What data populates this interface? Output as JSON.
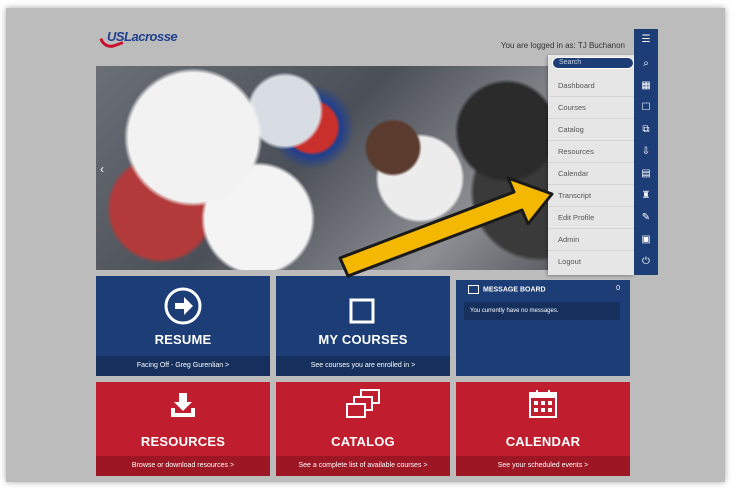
{
  "header": {
    "logo_text": "USLacrosse",
    "logged_in_text": "You are logged in as: TJ Buchanon"
  },
  "menu": {
    "search_placeholder": "Search",
    "items": [
      "Dashboard",
      "Courses",
      "Catalog",
      "Resources",
      "Calendar",
      "Transcript",
      "Edit Profile",
      "Admin",
      "Logout"
    ]
  },
  "iconbar": {
    "icons": [
      "menu-icon",
      "search-icon",
      "grid-icon",
      "courses-icon",
      "catalog-icon",
      "resources-icon",
      "calendar-icon",
      "transcript-icon",
      "edit-icon",
      "admin-icon",
      "power-icon"
    ]
  },
  "tiles": {
    "resume": {
      "label": "RESUME",
      "sub": "Facing Off - Greg Gurenlian  >"
    },
    "my_courses": {
      "label": "MY COURSES",
      "sub": "See courses you are enrolled in  >"
    },
    "resources": {
      "label": "RESOURCES",
      "sub": "Browse or download resources  >"
    },
    "catalog": {
      "label": "CATALOG",
      "sub": "See a complete list of available courses  >"
    },
    "calendar": {
      "label": "CALENDAR",
      "sub": "See your scheduled events  >"
    }
  },
  "message_board": {
    "title": "MESSAGE BOARD",
    "count": "0",
    "message": "You currently have no messages."
  },
  "colors": {
    "navy": "#1c3d76",
    "red": "#c01e2e",
    "annotation": "#f5b800"
  }
}
